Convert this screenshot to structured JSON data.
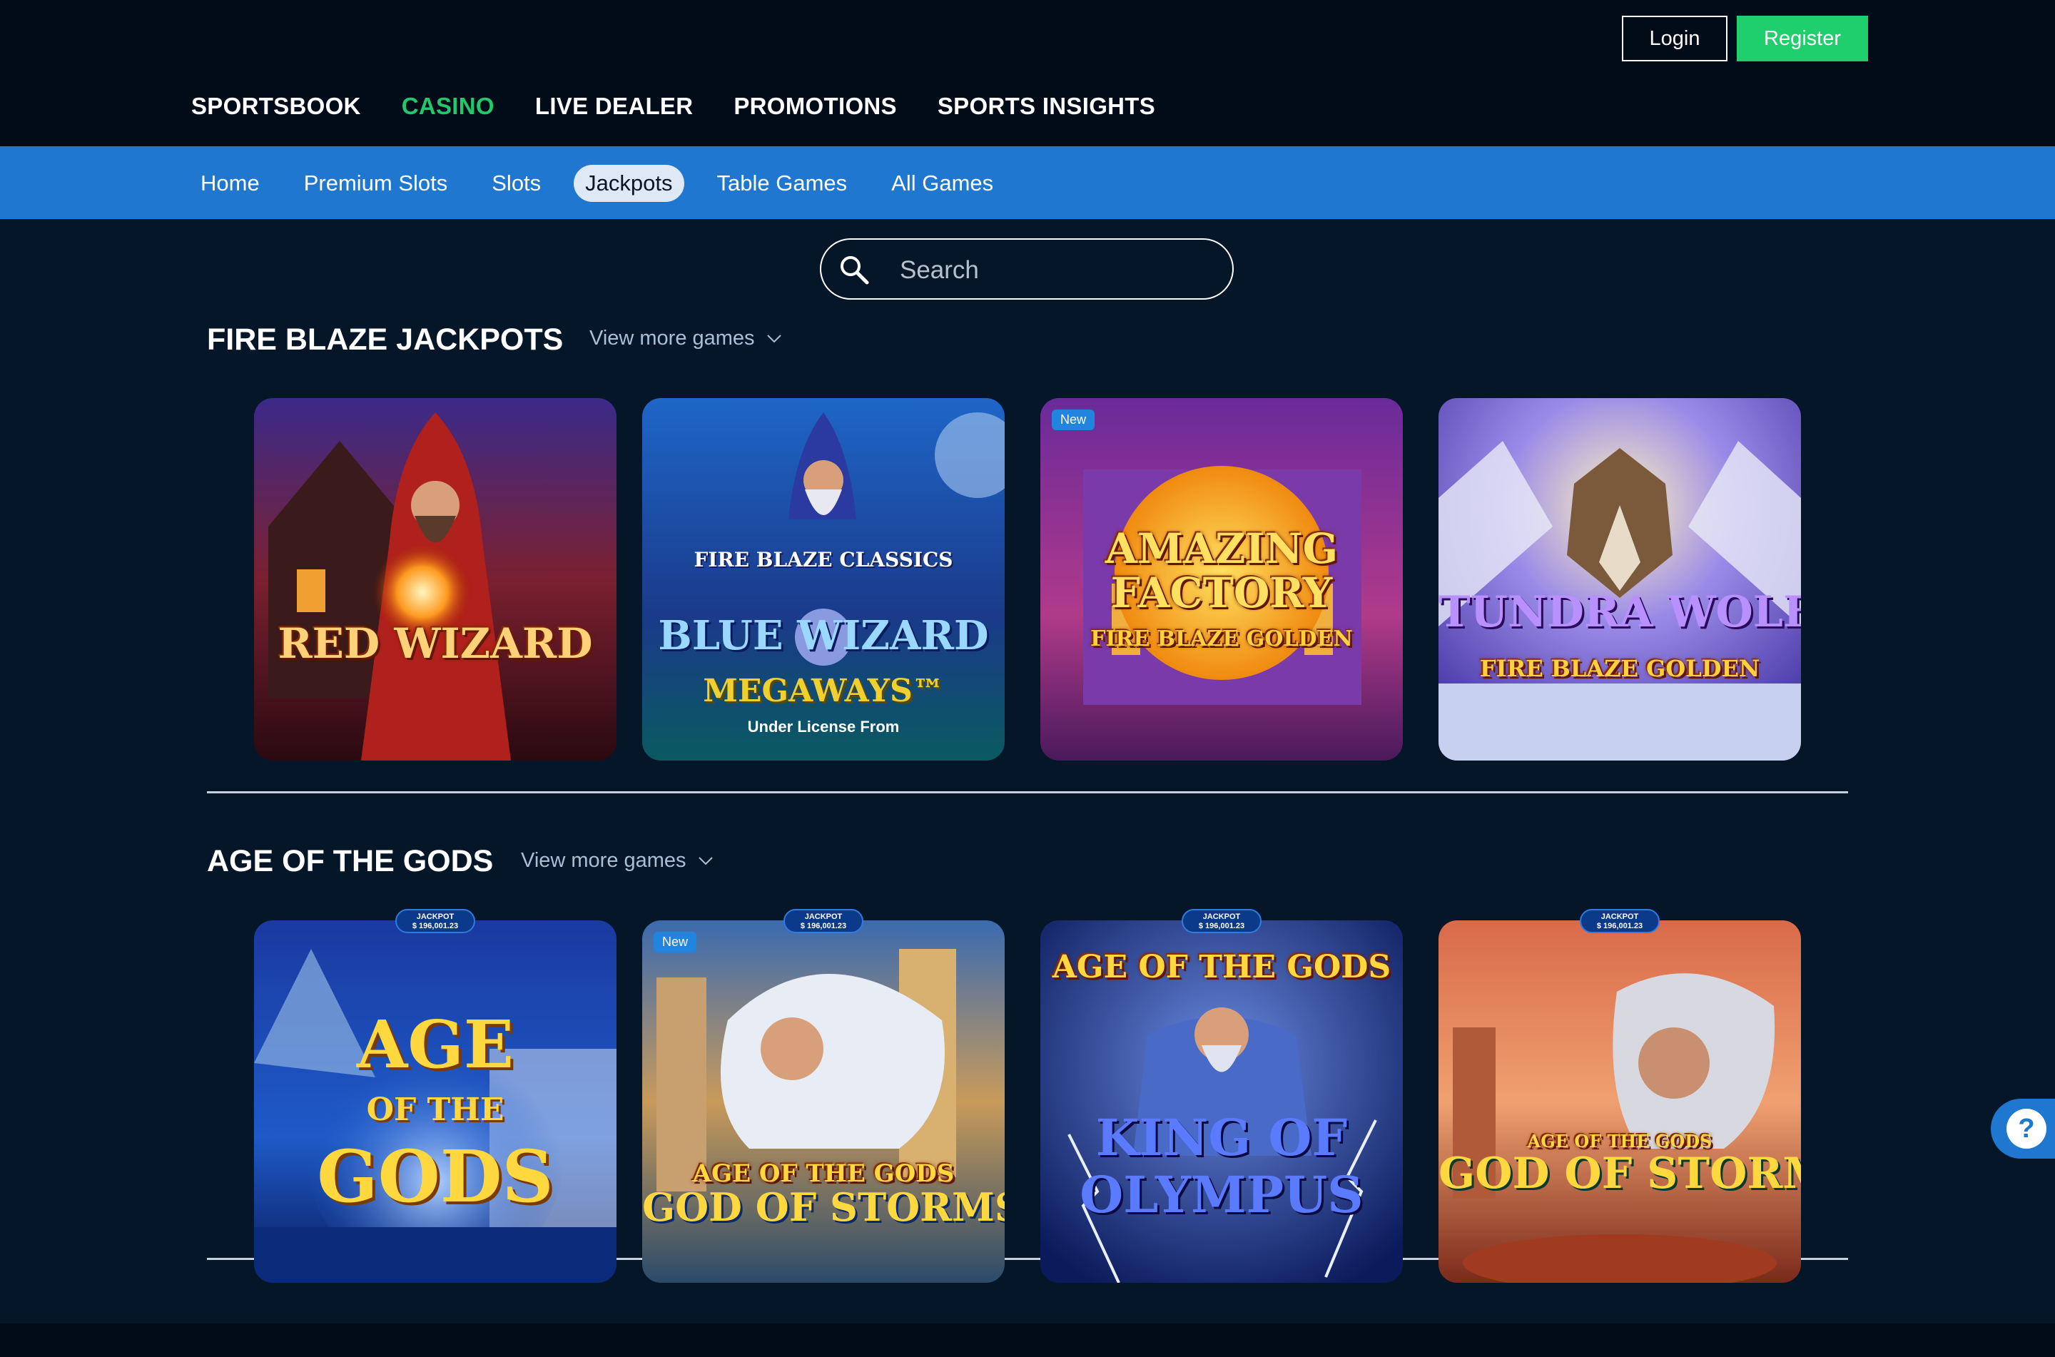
{
  "header": {
    "login_label": "Login",
    "register_label": "Register",
    "main_nav": [
      {
        "label": "SPORTSBOOK",
        "active": false
      },
      {
        "label": "CASINO",
        "active": true
      },
      {
        "label": "LIVE DEALER",
        "active": false
      },
      {
        "label": "PROMOTIONS",
        "active": false
      },
      {
        "label": "SPORTS INSIGHTS",
        "active": false
      }
    ]
  },
  "subnav": {
    "items": [
      "Home",
      "Premium Slots",
      "Slots",
      "Jackpots",
      "Table Games",
      "All Games"
    ],
    "active": "Jackpots"
  },
  "search": {
    "placeholder": "Search"
  },
  "sections": [
    {
      "title": "FIRE BLAZE JACKPOTS",
      "view_more": "View more games",
      "games": [
        {
          "logo": "RED WIZARD",
          "badge_new": ""
        },
        {
          "logo": "BLUE WIZARD",
          "sub": "FIRE BLAZE CLASSICS",
          "extra": "MEGAWAYS™",
          "license": "Under License From",
          "badge_new": ""
        },
        {
          "logo": "AMAZING FACTORY",
          "sub": "FIRE BLAZE GOLDEN",
          "badge_new": "New"
        },
        {
          "logo": "TUNDRA WOLF",
          "sub": "FIRE BLAZE GOLDEN",
          "badge_new": ""
        }
      ]
    },
    {
      "title": "AGE OF THE GODS",
      "view_more": "View more games",
      "games": [
        {
          "logo": "AGE OF THE GODS",
          "jackpot_label": "JACKPOT",
          "jackpot_value": "$ 196,001.23",
          "badge_new": ""
        },
        {
          "logo": "GOD OF STORMS",
          "sub": "AGE OF THE GODS",
          "jackpot_label": "JACKPOT",
          "jackpot_value": "$ 196,001.23",
          "badge_new": "New"
        },
        {
          "logo": "KING OF OLYMPUS",
          "sub": "AGE OF THE GODS",
          "jackpot_label": "JACKPOT",
          "jackpot_value": "$ 196,001.23",
          "badge_new": ""
        },
        {
          "logo": "GOD OF STORMS",
          "sub": "AGE OF THE GODS",
          "jackpot_label": "JACKPOT",
          "jackpot_value": "$ 196,001.23",
          "badge_new": ""
        }
      ]
    }
  ],
  "help": {
    "label": "?"
  },
  "colors": {
    "accent_green": "#22c86b",
    "subnav_blue": "#1f77d0",
    "background": "#061629"
  }
}
